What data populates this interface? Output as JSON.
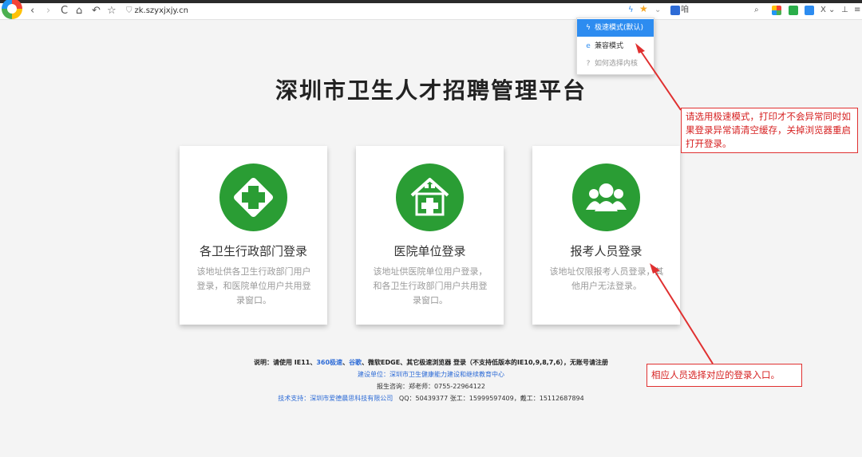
{
  "browser": {
    "url": "zk.szyxjxjy.cn",
    "nav_back": "‹",
    "nav_forward": "›",
    "nav_refresh": "C",
    "nav_home": "⌂",
    "nav_undo": "↶",
    "nav_star": "☆",
    "right_text": "咱",
    "right_more": "X ⌄",
    "right_download": "⊥",
    "right_menu": "≡"
  },
  "mode_menu": {
    "items": [
      {
        "label": "极速模式(默认)",
        "icon": "lightning-icon"
      },
      {
        "label": "兼容模式",
        "icon": "ie-icon"
      },
      {
        "label": "如何选择内核",
        "icon": "help-icon"
      }
    ]
  },
  "page": {
    "title": "深圳市卫生人才招聘管理平台",
    "cards": [
      {
        "title": "各卫生行政部门登录",
        "desc": "该地址供各卫生行政部门用户登录，和医院单位用户共用登录窗口。"
      },
      {
        "title": "医院单位登录",
        "desc": "该地址供医院单位用户登录，和各卫生行政部门用户共用登录窗口。"
      },
      {
        "title": "报考人员登录",
        "desc": "该地址仅限报考人员登录，其他用户无法登录。"
      }
    ]
  },
  "footer": {
    "line1_prefix": "说明：请使用 IE11、",
    "line1_360": "360极速",
    "line1_sep": "、",
    "line1_google": "谷歌",
    "line1_suffix": "、微软EDGE、其它极速浏览器 登录（不支持低版本的IE10,9,8,7,6），无账号请注册",
    "line2": "建设单位：深圳市卫生健康能力建设和继续教育中心",
    "line3": "报生咨询：郑老师：0755-22964122",
    "line4_prefix": "技术支持：深圳市爱德晨思科技有限公司",
    "line4_suffix": "QQ：50439377   张工：15999597409，戴工：15112687894"
  },
  "annotations": {
    "note1": "请选用极速模式，打印才不会异常同时如果登录异常请清空缓存，关掉浏览器重启打开登录。",
    "note2": "相应人员选择对应的登录入口。"
  },
  "colors": {
    "accent_green": "#2a9d34",
    "annotation_red": "#e03030",
    "link_blue": "#2d6bd6",
    "menu_active": "#2d8cf0"
  }
}
